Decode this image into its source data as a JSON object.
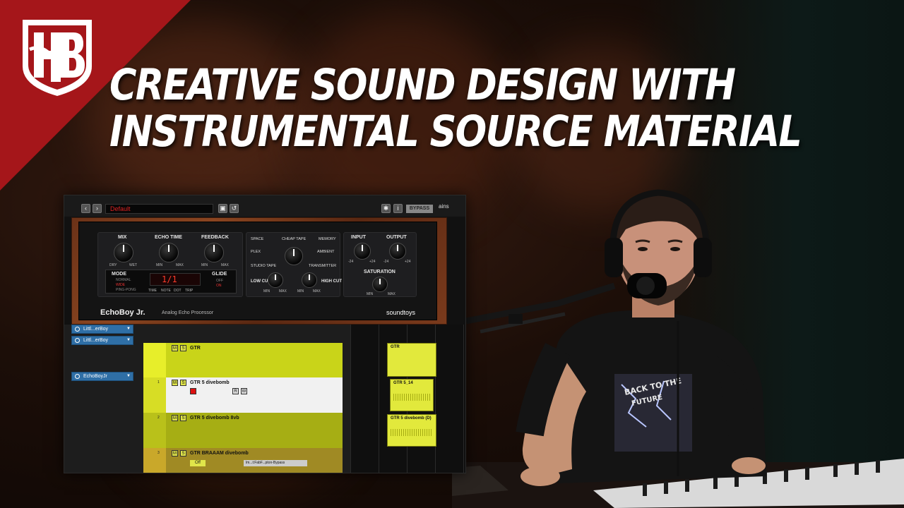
{
  "thumbnail": {
    "title_line1": "CREATIVE SOUND DESIGN WITH",
    "title_line2": "INSTRUMENTAL SOURCE MATERIAL",
    "accent_color": "#a5161a",
    "logo_icon": "hb-shield-logo-icon"
  },
  "plugin_window": {
    "preset_name": "Default",
    "bypass_label": "BYPASS",
    "mains_label": "ains",
    "plugin_name": "EchoBoy Jr.",
    "plugin_subtitle": "Analog Echo Processor",
    "brand": "soundtoys",
    "knobs": {
      "mix": "MIX",
      "echo_time": "ECHO TIME",
      "feedback": "FEEDBACK",
      "input": "INPUT",
      "output": "OUTPUT",
      "saturation": "SATURATION",
      "low_cut": "LOW CUT",
      "high_cut": "HIGH CUT"
    },
    "knob_min_labels": {
      "mix_min": "DRY",
      "mix_max": "WET",
      "time_min": "MIN",
      "time_max": "MAX",
      "fb_min": "MIN",
      "fb_max": "MAX",
      "in_min": "-24",
      "in_max": "+24",
      "out_min": "-24",
      "out_max": "+24",
      "sat_min": "MIN",
      "sat_max": "MAX",
      "lc_min": "MIN",
      "lc_max": "MAX",
      "hc_min": "MIN",
      "hc_max": "MAX"
    },
    "styles": {
      "space": "SPACE",
      "cheap_tape": "CHEAP TAPE",
      "memory": "MEMORY",
      "plex": "PLEX",
      "ambient": "AMBIENT",
      "studio_tape": "STUDIO TAPE",
      "transmitter": "TRANSMITTER"
    },
    "mode": {
      "label": "MODE",
      "options": [
        "NORMAL",
        "WIDE",
        "PING-PONG"
      ],
      "selected": "WIDE"
    },
    "display": {
      "value": "1/1",
      "units": [
        "TIME",
        "NOTE",
        "DOT",
        "TRIP"
      ]
    },
    "glide": {
      "label": "GLIDE",
      "off": "OFF",
      "on": "ON"
    }
  },
  "inserts": [
    {
      "label": "Littl...erBoy"
    },
    {
      "label": "Littl...erBoy"
    },
    {
      "label": "EchoBoyJr"
    }
  ],
  "tracks": [
    {
      "name": "GTR",
      "color": "#c9d419"
    },
    {
      "name": "GTR 5 divebomb",
      "number": "1",
      "color": "#f1f1f1"
    },
    {
      "name": "GTR 5 divebomb 8vb",
      "number": "2",
      "color": "#c9d419"
    },
    {
      "name": "GTR BRAAAM divebomb",
      "number": "3",
      "color": "#c9d419",
      "off_label": "Off",
      "insert_label": "lm...t:FabF...pton-Bypass"
    }
  ],
  "clips": [
    {
      "name": "GTR"
    },
    {
      "name": "GTR 5_14"
    },
    {
      "name": "GTR 5 divebomb (D)"
    }
  ],
  "track_buttons": {
    "mute": "M",
    "solo": "S",
    "read": "R",
    "write": "W"
  }
}
